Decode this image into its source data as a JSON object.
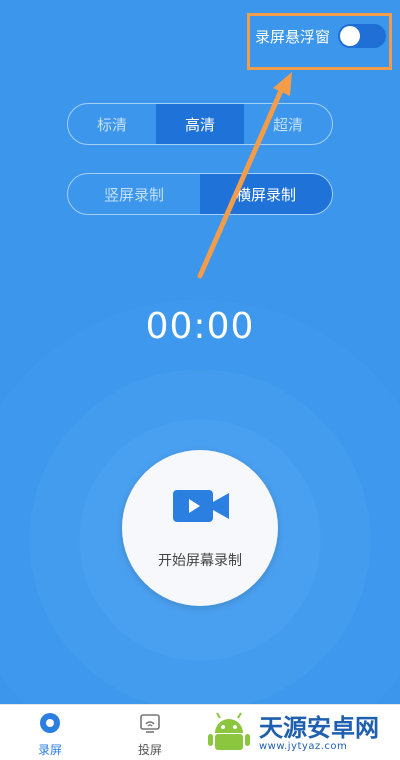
{
  "header": {
    "floating_window_label": "录屏悬浮窗",
    "floating_window_enabled": true
  },
  "quality_tabs": [
    {
      "label": "标清",
      "active": false
    },
    {
      "label": "高清",
      "active": true
    },
    {
      "label": "超清",
      "active": false
    }
  ],
  "orientation_tabs": [
    {
      "label": "竖屏录制",
      "active": false
    },
    {
      "label": "横屏录制",
      "active": true
    }
  ],
  "timer": "00:00",
  "record_button": {
    "label": "开始屏幕录制",
    "icon": "video-camera-icon"
  },
  "bottom_nav": [
    {
      "label": "录屏",
      "icon": "record-icon",
      "active": true
    },
    {
      "label": "投屏",
      "icon": "cast-icon",
      "active": false
    }
  ],
  "watermark": {
    "title": "天源安卓网",
    "url": "www.jytyaz.com"
  },
  "colors": {
    "background": "#3d98ee",
    "active_tab": "#1f73d8",
    "highlight": "#f39c4a",
    "nav_active": "#2a7fe0"
  }
}
